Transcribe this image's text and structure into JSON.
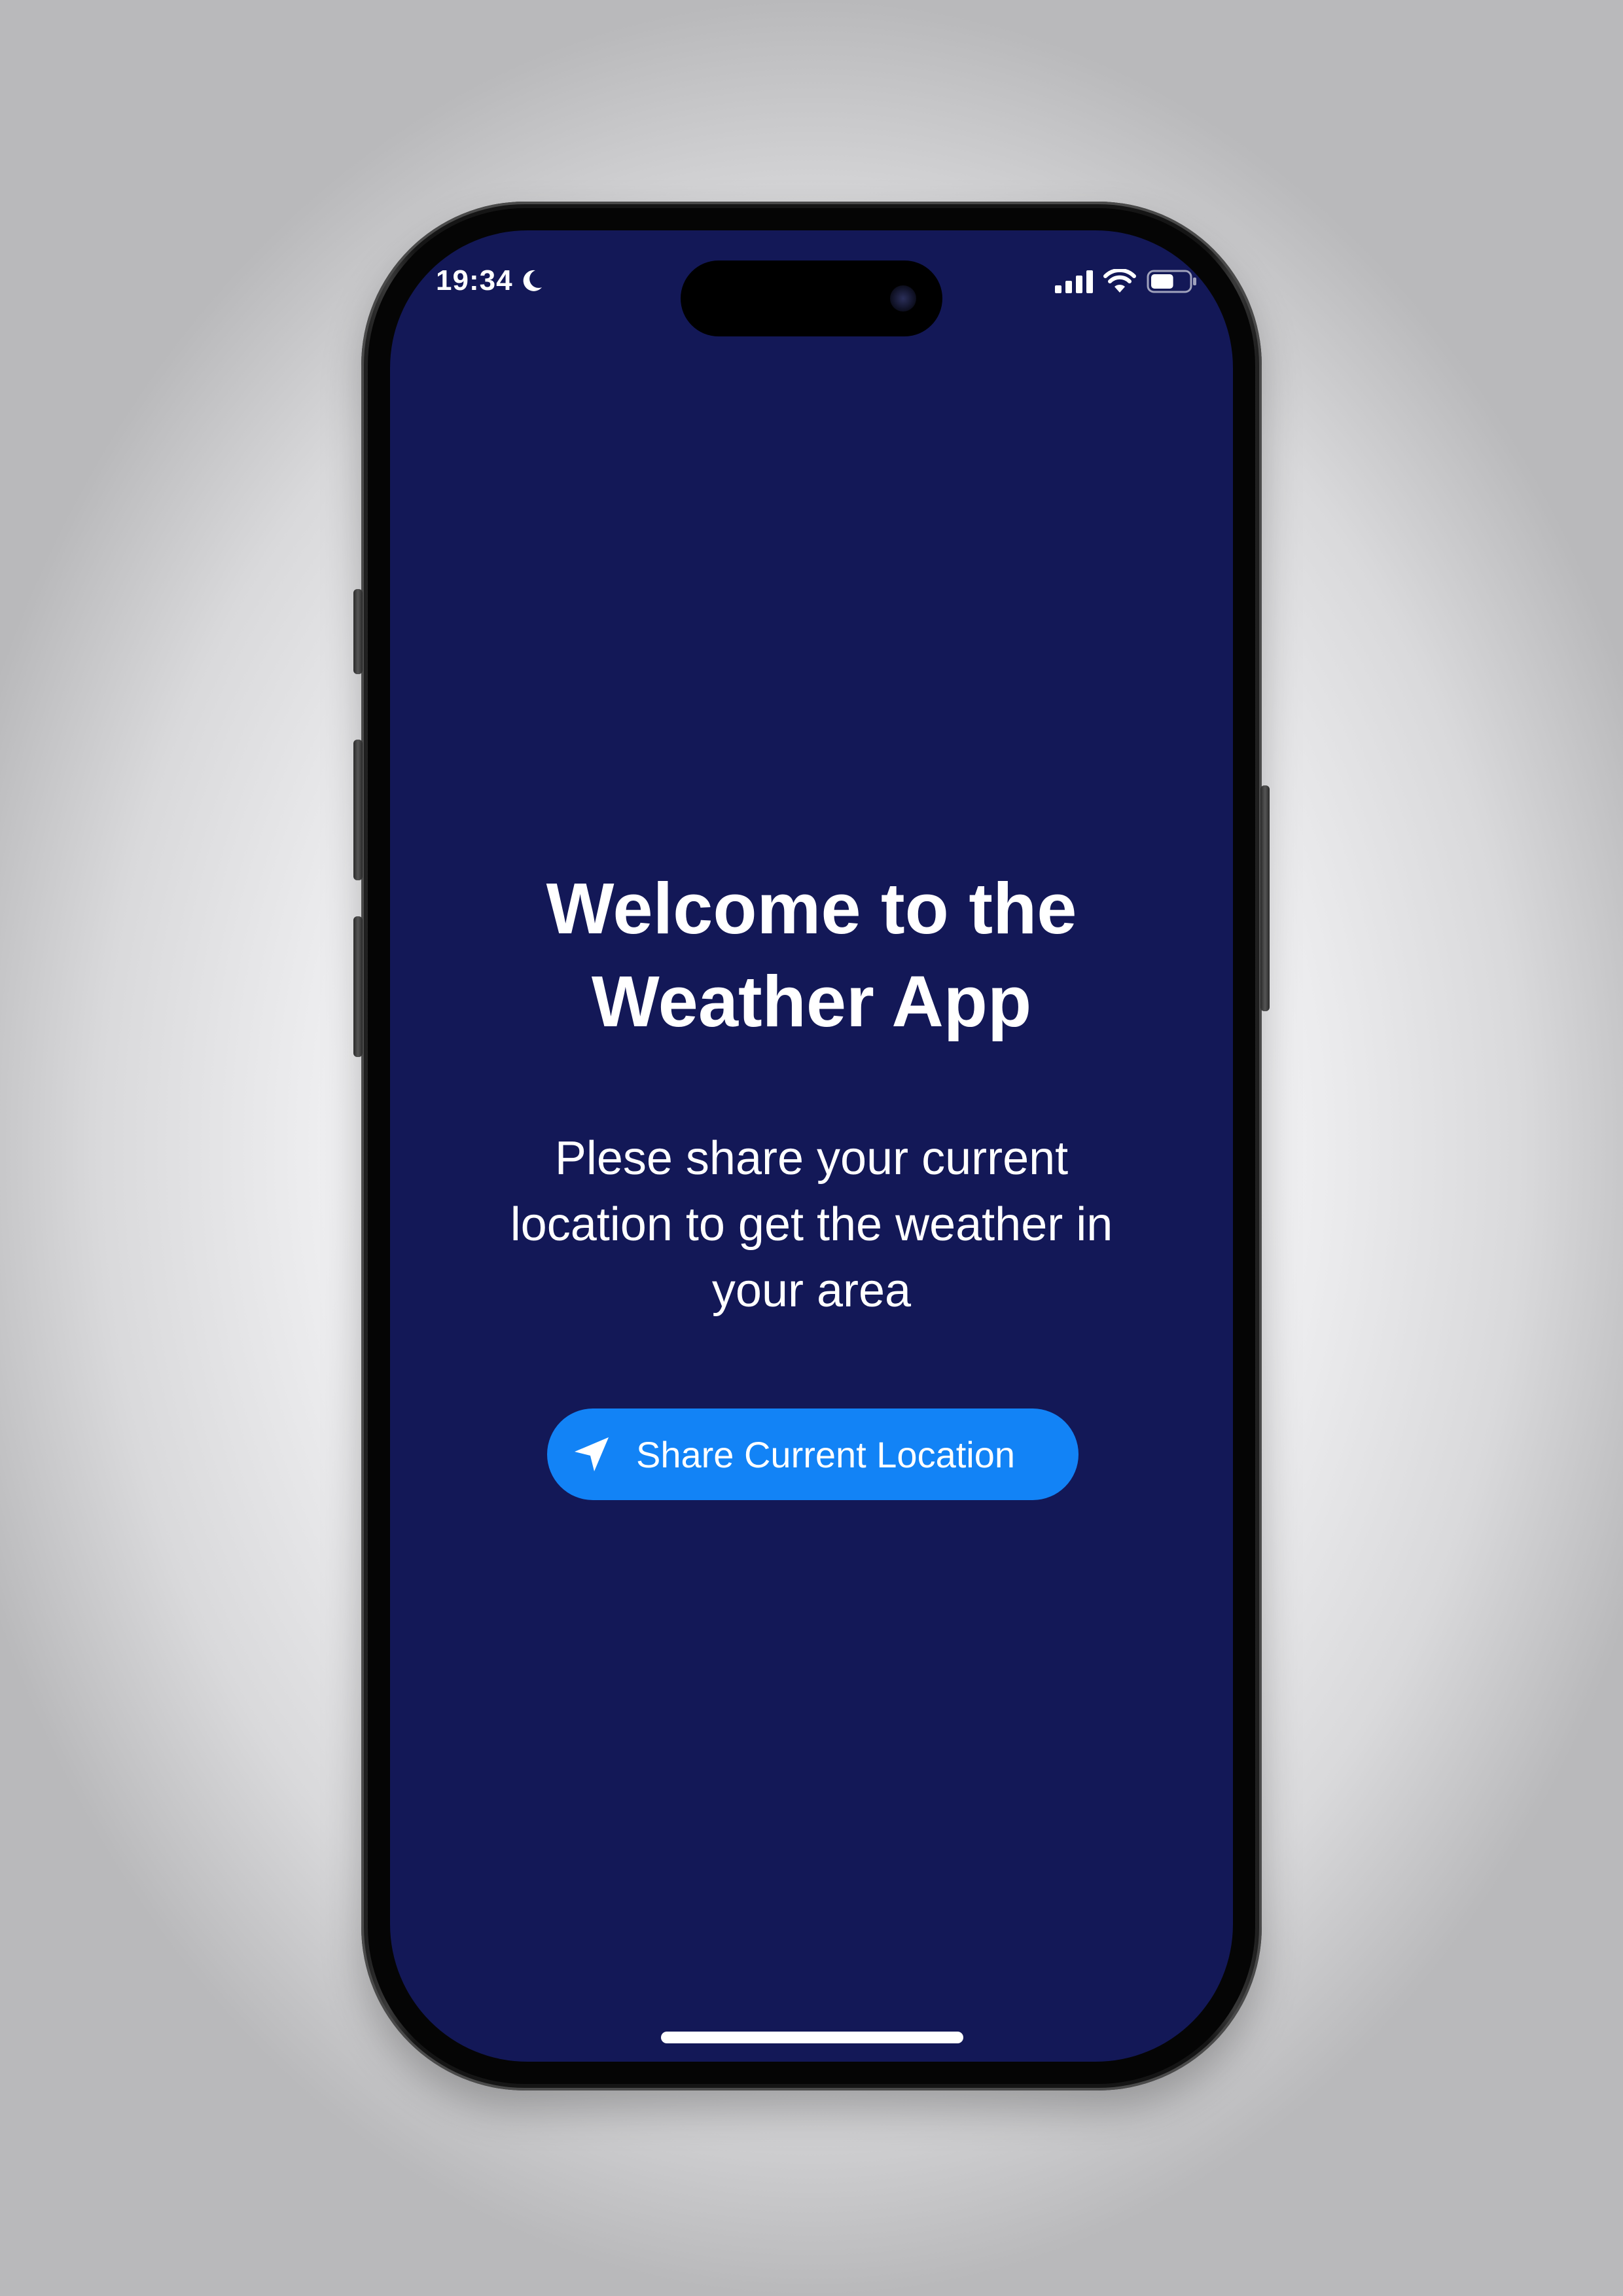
{
  "status_bar": {
    "time": "19:34",
    "focus_icon": "moon-icon",
    "signal_icon": "cellular-signal-icon",
    "wifi_icon": "wifi-icon",
    "battery_icon": "battery-icon",
    "battery_level": 0.6
  },
  "main": {
    "title_line1": "Welcome to the",
    "title_line2": "Weather App",
    "subtitle_line1": "Plese share your current",
    "subtitle_line2": "location to get the weather in",
    "subtitle_line3": "your area",
    "share_button_label": "Share Current Location",
    "share_button_icon": "location-arrow-icon"
  },
  "colors": {
    "screen_background": "#131857",
    "button_background": "#1283f6",
    "text": "#ffffff"
  }
}
